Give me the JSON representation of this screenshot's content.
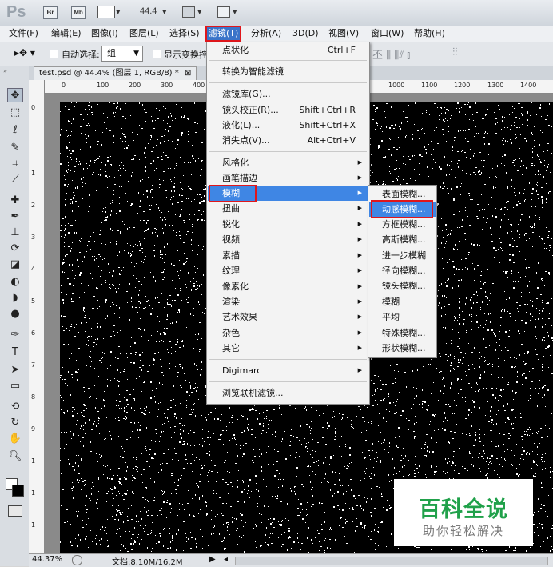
{
  "titlebar": {
    "logo": "Ps",
    "bridge": "Br",
    "minibridge": "Mb",
    "zoom": "44.4"
  },
  "menubar": [
    "文件(F)",
    "编辑(E)",
    "图像(I)",
    "图层(L)",
    "选择(S)",
    "滤镜(T)",
    "分析(A)",
    "3D(D)",
    "视图(V)",
    "窗口(W)",
    "帮助(H)"
  ],
  "options": {
    "auto_select_label": "自动选择:",
    "auto_select_value": "组",
    "show_transform_label": "显示变换控"
  },
  "document": {
    "tab_title": "test.psd @ 44.4% (图层 1, RGB/8) *",
    "close": "⊠"
  },
  "ruler": {
    "h_ticks_left": [
      "0",
      "100",
      "200",
      "300",
      "400"
    ],
    "h_ticks_right": [
      "1000",
      "1100",
      "1200",
      "1300",
      "1400"
    ],
    "v_ticks": [
      "0",
      "1",
      "2",
      "3",
      "4",
      "5",
      "6",
      "7",
      "8",
      "9",
      "1",
      "1",
      "1"
    ]
  },
  "status": {
    "zoom": "44.37%",
    "doc": "文档:8.10M/16.2M"
  },
  "filter_menu": {
    "items": [
      {
        "label": "点状化",
        "shortcut": "Ctrl+F"
      },
      {
        "label": "转换为智能滤镜"
      },
      {
        "label": "滤镜库(G)..."
      },
      {
        "label": "镜头校正(R)...",
        "shortcut": "Shift+Ctrl+R"
      },
      {
        "label": "液化(L)...",
        "shortcut": "Shift+Ctrl+X"
      },
      {
        "label": "消失点(V)...",
        "shortcut": "Alt+Ctrl+V"
      },
      {
        "label": "风格化"
      },
      {
        "label": "画笔描边"
      },
      {
        "label": "模糊"
      },
      {
        "label": "扭曲"
      },
      {
        "label": "锐化"
      },
      {
        "label": "视频"
      },
      {
        "label": "素描"
      },
      {
        "label": "纹理"
      },
      {
        "label": "像素化"
      },
      {
        "label": "渲染"
      },
      {
        "label": "艺术效果"
      },
      {
        "label": "杂色"
      },
      {
        "label": "其它"
      },
      {
        "label": "Digimarc"
      },
      {
        "label": "浏览联机滤镜..."
      }
    ]
  },
  "blur_submenu": {
    "items": [
      "表面模糊...",
      "动感模糊...",
      "方框模糊...",
      "高斯模糊...",
      "进一步模糊",
      "径向模糊...",
      "镜头模糊...",
      "模糊",
      "平均",
      "特殊模糊...",
      "形状模糊..."
    ]
  },
  "watermark": {
    "title": "百科全说",
    "subtitle": "助你轻松解决"
  },
  "colors": {
    "highlight": "#3f86e4",
    "annotation_red": "#e0161b",
    "watermark_green": "#20a14a"
  }
}
